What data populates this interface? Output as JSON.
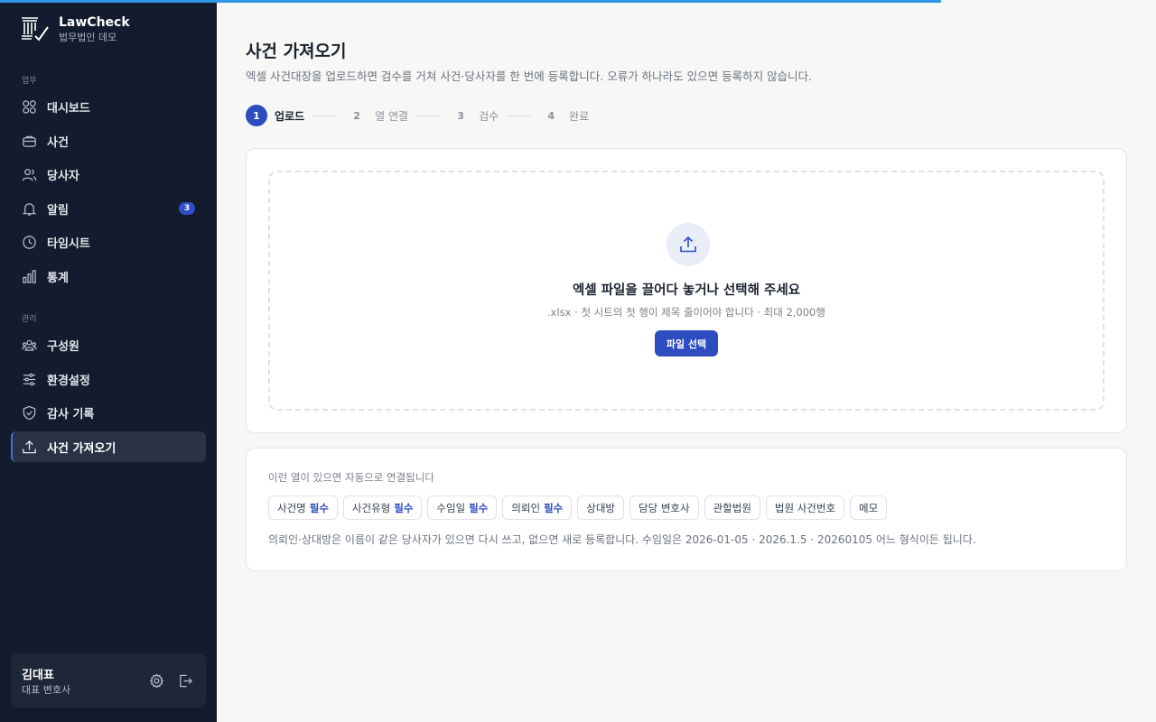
{
  "brand": {
    "name": "LawCheck",
    "subtitle": "법무법인 데모"
  },
  "sidebar": {
    "section_work": "업무",
    "section_admin": "관리",
    "items": [
      {
        "label": "대시보드",
        "icon": "grid-icon"
      },
      {
        "label": "사건",
        "icon": "briefcase-icon"
      },
      {
        "label": "당사자",
        "icon": "users-icon"
      },
      {
        "label": "알림",
        "icon": "bell-icon",
        "badge": "3"
      },
      {
        "label": "타임시트",
        "icon": "clock-icon"
      },
      {
        "label": "통계",
        "icon": "bar-chart-icon"
      },
      {
        "label": "구성원",
        "icon": "team-icon"
      },
      {
        "label": "환경설정",
        "icon": "sliders-icon"
      },
      {
        "label": "감사 기록",
        "icon": "shield-check-icon"
      },
      {
        "label": "사건 가져오기",
        "icon": "upload-icon",
        "active": true
      }
    ]
  },
  "user": {
    "name": "김대표",
    "role": "대표 변호사"
  },
  "page": {
    "title": "사건 가져오기",
    "description": "엑셀 사건대장을 업로드하면 검수를 거쳐 사건·당사자를 한 번에 등록합니다. 오류가 하나라도 있으면 등록하지 않습니다."
  },
  "steps": [
    {
      "num": "1",
      "label": "업로드",
      "active": true
    },
    {
      "num": "2",
      "label": "열 연결"
    },
    {
      "num": "3",
      "label": "검수"
    },
    {
      "num": "4",
      "label": "완료"
    }
  ],
  "upload": {
    "title": "엑셀 파일을 끌어다 놓거나 선택해 주세요",
    "subtitle": ".xlsx · 첫 시트의 첫 행이 제목 줄이어야 합니다 · 최대 2,000행",
    "button": "파일 선택"
  },
  "columns": {
    "title": "이런 열이 있으면 자동으로 연결됩니다",
    "required_label": "필수",
    "chips": [
      {
        "label": "사건명",
        "required": true
      },
      {
        "label": "사건유형",
        "required": true
      },
      {
        "label": "수임일",
        "required": true
      },
      {
        "label": "의뢰인",
        "required": true
      },
      {
        "label": "상대방"
      },
      {
        "label": "담당 변호사"
      },
      {
        "label": "관할법원"
      },
      {
        "label": "법원 사건번호"
      },
      {
        "label": "메모"
      }
    ],
    "note": "의뢰인·상대방은 이름이 같은 당사자가 있으면 다시 쓰고, 없으면 새로 등록합니다. 수임일은 2026-01-05 · 2026.1.5 · 20260105 어느 형식이든 됩니다."
  },
  "colors": {
    "accent": "#2d4cc0",
    "sidebar_bg": "#131c2e",
    "progress": "#2f95e6"
  }
}
